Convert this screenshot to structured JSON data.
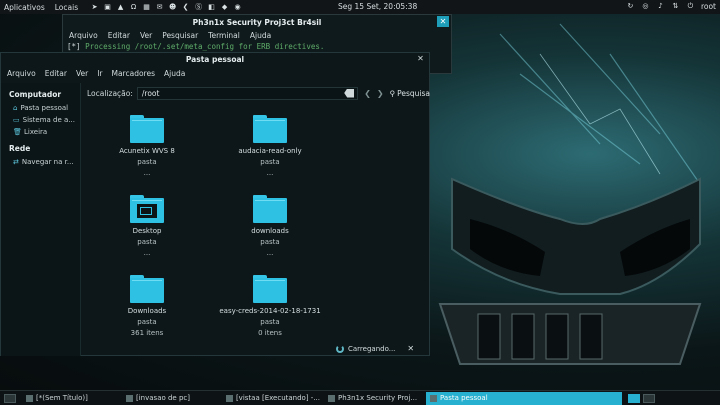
{
  "top_panel": {
    "applications": "Aplicativos",
    "places": "Locais",
    "clock": "Seg 15 Set, 20:05:38",
    "user": "root",
    "left_icons": [
      "arrow-icon",
      "terminal-icon",
      "triangle-icon",
      "omega-icon",
      "grid-icon",
      "mail-icon",
      "people-icon",
      "brackets-icon",
      "skype-icon",
      "box-icon",
      "shield-icon",
      "globe-icon"
    ],
    "right_icons": [
      "sync-icon",
      "chrome-icon",
      "speaker-icon",
      "network-icon",
      "power-icon"
    ]
  },
  "terminal": {
    "title": "Ph3n1x Security Proj3ct Br4sil",
    "menu": [
      "Arquivo",
      "Editar",
      "Ver",
      "Pesquisar",
      "Terminal",
      "Ajuda"
    ],
    "line_prefix": "[*]",
    "line_text": "Processing /root/.set/meta_config for ERB directives."
  },
  "file_manager": {
    "title": "Pasta pessoal",
    "menu": [
      "Arquivo",
      "Editar",
      "Ver",
      "Ir",
      "Marcadores",
      "Ajuda"
    ],
    "sidebar": {
      "computer_heading": "Computador",
      "computer_items": [
        {
          "label": "Pasta pessoal",
          "icon": "home-icon"
        },
        {
          "label": "Sistema de a...",
          "icon": "drive-icon"
        },
        {
          "label": "Lixeira",
          "icon": "trash-icon"
        }
      ],
      "network_heading": "Rede",
      "network_items": [
        {
          "label": "Navegar na r...",
          "icon": "network-icon"
        }
      ]
    },
    "location": {
      "label": "Localização:",
      "value": "/root",
      "search_label": "Pesquisa"
    },
    "items": [
      {
        "name": "Acunetix WVS 8",
        "type": "pasta",
        "info": "..."
      },
      {
        "name": "audacia-read-only",
        "type": "pasta",
        "info": "..."
      },
      {
        "name": "Desktop",
        "type": "pasta",
        "info": "..."
      },
      {
        "name": "downloads",
        "type": "pasta",
        "info": "..."
      },
      {
        "name": "Downloads",
        "type": "pasta",
        "info": "361 itens"
      },
      {
        "name": "easy-creds-2014-02-18-1731",
        "type": "pasta",
        "info": "0 itens"
      }
    ],
    "loading_text": "Carregando..."
  },
  "taskbar": {
    "items": [
      {
        "label": "[*(Sem Título)]",
        "active": false
      },
      {
        "label": "[invasao de pc]",
        "active": false
      },
      {
        "label": "[vistaa [Executando] -...",
        "active": false
      },
      {
        "label": "Ph3n1x Security Proj...",
        "active": false
      },
      {
        "label": "Pasta pessoal",
        "active": true
      }
    ]
  },
  "colors": {
    "accent": "#27b0cf",
    "folder": "#2fc1e3",
    "terminal_text": "#5fae6a"
  }
}
